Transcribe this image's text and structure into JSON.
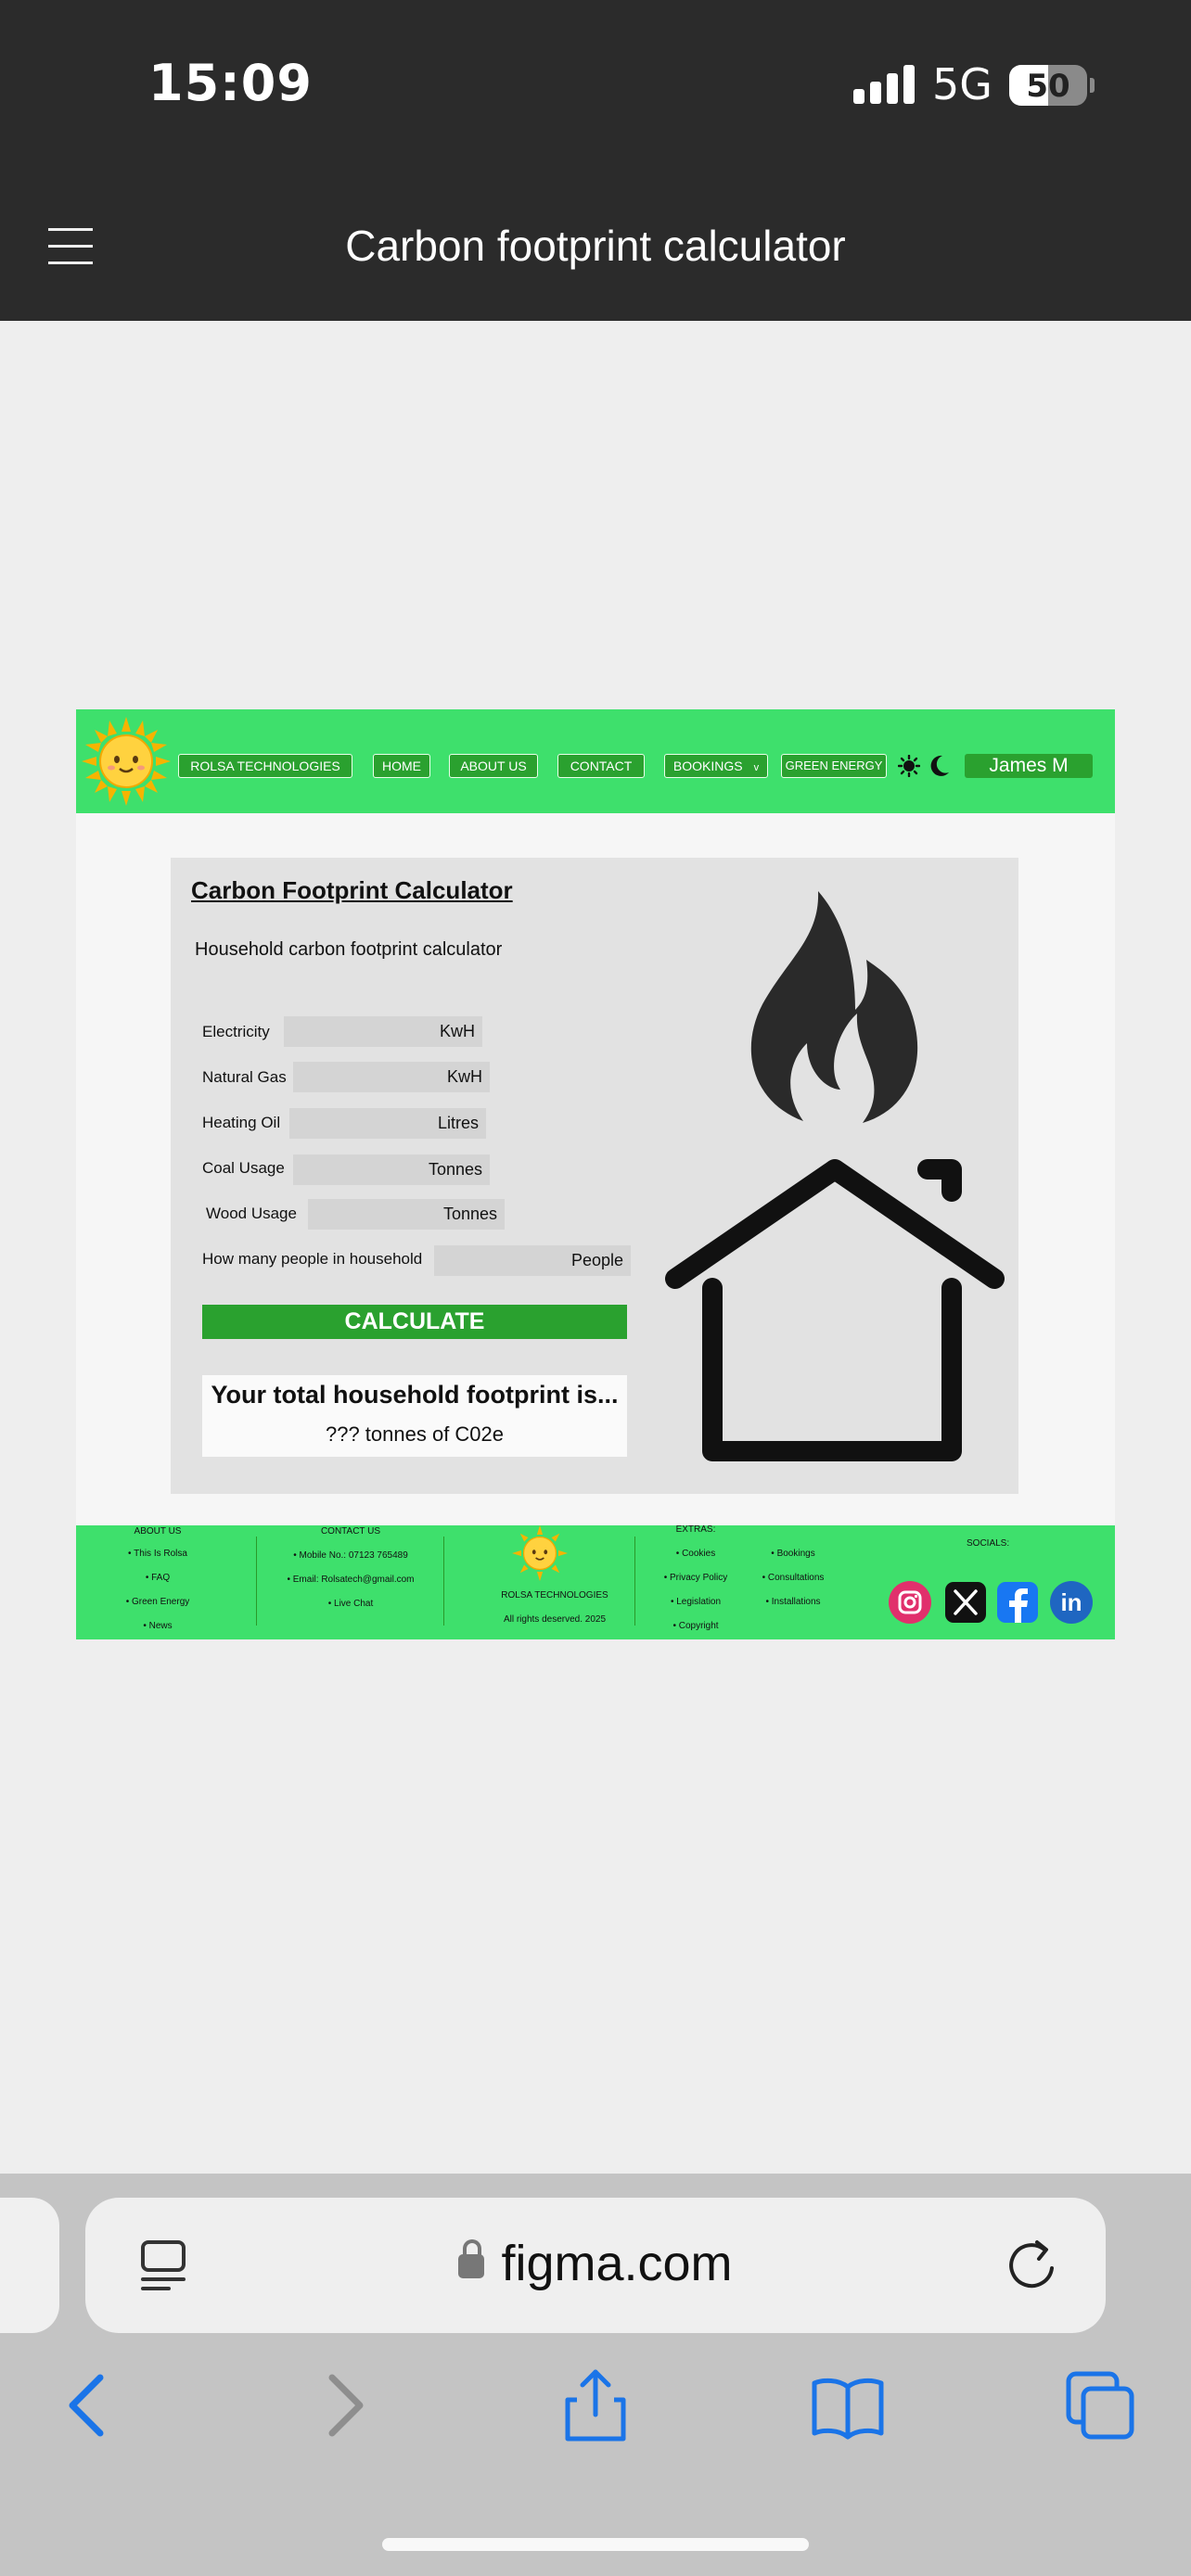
{
  "status": {
    "time": "15:09",
    "network": "5G",
    "battery": "50"
  },
  "header": {
    "title": "Carbon footprint calculator"
  },
  "site": {
    "nav": {
      "brand": "ROLSA TECHNOLOGIES",
      "home": "HOME",
      "about": "ABOUT US",
      "contact": "CONTACT",
      "bookings": "BOOKINGS",
      "bookings_chevron": "v",
      "green": "GREEN ENERGY",
      "user": "James M"
    },
    "calculator": {
      "title": "Carbon Footprint Calculator",
      "subtitle": "Household carbon footprint calculator",
      "rows": [
        {
          "label": "Electricity",
          "unit": "KwH"
        },
        {
          "label": "Natural Gas",
          "unit": "KwH"
        },
        {
          "label": "Heating Oil",
          "unit": "Litres"
        },
        {
          "label": "Coal Usage",
          "unit": "Tonnes"
        },
        {
          "label": "Wood Usage",
          "unit": "Tonnes"
        },
        {
          "label": "How many people in household",
          "unit": "People"
        }
      ],
      "button": "CALCULATE",
      "result_heading": "Your total household footprint is...",
      "result_value": "??? tonnes of C02e"
    },
    "footer": {
      "about": {
        "heading": "ABOUT US",
        "items": [
          "This Is Rolsa",
          "FAQ",
          "Green Energy",
          "News"
        ]
      },
      "contact": {
        "heading": "CONTACT US",
        "items": [
          "Mobile No.: 07123 765489",
          "Email: Rolsatech@gmail.com",
          "Live Chat"
        ]
      },
      "brand": "ROLSA TECHNOLOGIES",
      "rights": "All rights deserved. 2025",
      "extras": {
        "heading": "EXTRAS:",
        "col1": [
          "Cookies",
          "Privacy Policy",
          "Legislation",
          "Copyright"
        ],
        "col2": [
          "Bookings",
          "Consultations",
          "Installations"
        ]
      },
      "socials": {
        "heading": "SOCIALS:",
        "linkedin_text": "in"
      }
    }
  },
  "browser": {
    "url": "figma.com"
  },
  "colors": {
    "nav_green": "#3ee06c",
    "button_green": "#2aa12f",
    "instagram": "#e1306c",
    "facebook": "#1877f2",
    "linkedin": "#1f66c1",
    "ios_blue": "#1a74e8"
  }
}
